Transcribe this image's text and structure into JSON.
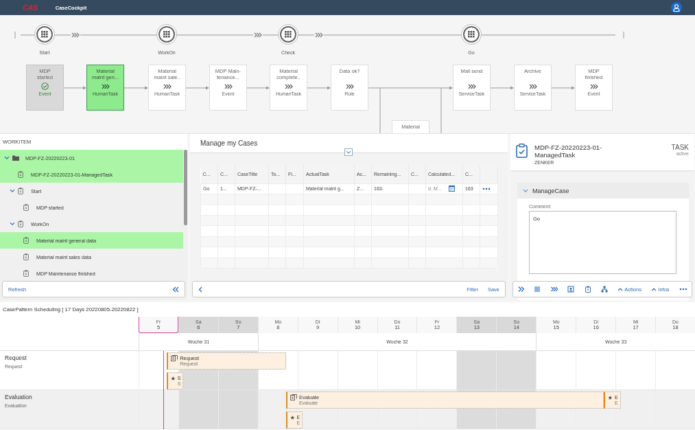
{
  "app": {
    "logo": "CAS",
    "title": "CaseCockpit"
  },
  "milestones": [
    {
      "label": "Start"
    },
    {
      "label": "WorkOn"
    },
    {
      "label": "Check"
    },
    {
      "label": "Go"
    }
  ],
  "tasks": [
    {
      "title": "MDP started",
      "type": "Event",
      "completed": true,
      "selected": false
    },
    {
      "title": "Material maint gen...",
      "type": "HumanTask",
      "completed": false,
      "selected": true
    },
    {
      "title": "Material maint sale..",
      "type": "HumanTask",
      "completed": false,
      "selected": false
    },
    {
      "title": "MDP Main-tenance...",
      "type": "Event",
      "completed": false,
      "selected": false
    },
    {
      "title": "Material complete..",
      "type": "HumanTask",
      "completed": false,
      "selected": false
    },
    {
      "title": "Data ok?",
      "type": "Rule",
      "completed": false,
      "selected": false
    },
    {
      "title": "Mail send",
      "type": "ServiceTask",
      "completed": false,
      "selected": false
    },
    {
      "title": "Archive",
      "type": "ServiceTask",
      "completed": false,
      "selected": false
    },
    {
      "title": "MDP finished",
      "type": "Event",
      "completed": false,
      "selected": false
    }
  ],
  "branch_task": {
    "title": "Material"
  },
  "workitem": {
    "title": "WORKITEM",
    "refresh": "Refresh",
    "tree": [
      {
        "label": "MDP-FZ-20220223-01",
        "kind": "folder",
        "selected": true,
        "expanded": true,
        "children": [
          {
            "label": "MDP-FZ-20220223-01-ManagedTask",
            "kind": "task",
            "selected": true
          },
          {
            "label": "Start",
            "kind": "task",
            "selected": false,
            "expanded": true,
            "children": [
              {
                "label": "MDP started",
                "kind": "task",
                "selected": false
              }
            ]
          },
          {
            "label": "WorkOn",
            "kind": "task",
            "selected": false,
            "expanded": true,
            "children": [
              {
                "label": "Material maint general data",
                "kind": "task",
                "selected": true
              },
              {
                "label": "Material maint sales data",
                "kind": "task",
                "selected": false
              },
              {
                "label": "MDP Maintenance finished",
                "kind": "task",
                "selected": false
              }
            ]
          }
        ]
      }
    ]
  },
  "cases": {
    "title": "Manage my Cases",
    "columns": [
      "C...",
      "C...",
      "CaseTitle",
      "To...",
      "Fi...",
      "ActualTask",
      "Ac...",
      "Remaining...",
      "C...",
      "Calculated...",
      "C..."
    ],
    "rows": [
      {
        "cells": [
          "Go",
          "1...",
          "MDP-FZ-...",
          null,
          null,
          "Material maint g...",
          "Z...",
          "163-",
          null,
          {
            "kind": "date",
            "placeholder": "d. M..."
          },
          "163"
        ]
      }
    ],
    "toolbar": [
      "Filter",
      "Save"
    ]
  },
  "task": {
    "title": "MDP-FZ-20220223-01-ManagedTask",
    "subtitle": "ZENKER",
    "type": "TASK",
    "status": "active",
    "section": {
      "title": "ManageCase",
      "expanded": true,
      "field_label": "Comment:",
      "value": "Go"
    },
    "menus": [
      "Actions",
      "Infos"
    ]
  },
  "scheduler": {
    "title": "CasePattern Scheduling [ 17 Days 20220805-20220822 ]",
    "weeks": [
      {
        "label": "Woche 31",
        "days": [
          {
            "weekday": "Fr",
            "day": "5",
            "weekend": false,
            "today": true
          },
          {
            "weekday": "Sa",
            "day": "6",
            "weekend": true,
            "today": false
          },
          {
            "weekday": "So",
            "day": "7",
            "weekend": true,
            "today": false
          }
        ]
      },
      {
        "label": "Woche 32",
        "days": [
          {
            "weekday": "Mo",
            "day": "8",
            "weekend": false,
            "today": false
          },
          {
            "weekday": "Di",
            "day": "9",
            "weekend": false,
            "today": false
          },
          {
            "weekday": "Mi",
            "day": "10",
            "weekend": false,
            "today": false
          },
          {
            "weekday": "Do",
            "day": "11",
            "weekend": false,
            "today": false
          },
          {
            "weekday": "Fr",
            "day": "12",
            "weekend": false,
            "today": false
          },
          {
            "weekday": "Sa",
            "day": "13",
            "weekend": true,
            "today": false
          },
          {
            "weekday": "So",
            "day": "14",
            "weekend": true,
            "today": false
          }
        ]
      },
      {
        "label": "Woche 33",
        "days": [
          {
            "weekday": "Mo",
            "day": "15",
            "weekend": false,
            "today": false
          },
          {
            "weekday": "Di",
            "day": "16",
            "weekend": false,
            "today": false
          },
          {
            "weekday": "Mi",
            "day": "17",
            "weekend": false,
            "today": false
          },
          {
            "weekday": "Do",
            "day": "18",
            "weekend": false,
            "today": false
          }
        ]
      }
    ],
    "lanes": [
      {
        "title": "Request",
        "subtitle": "Request",
        "tracks": [
          [
            {
              "kind": "task",
              "title": "Request",
              "subtitle": "Request"
            }
          ],
          [
            {
              "kind": "milestone",
              "title": "S",
              "subtitle": "S"
            }
          ]
        ]
      },
      {
        "title": "Evaluation",
        "subtitle": "Evaluation",
        "tracks": [
          [
            {
              "kind": "task",
              "title": "Evaluate",
              "subtitle": "Evaluate"
            },
            {
              "kind": "milestone",
              "title": "E",
              "subtitle": "E"
            }
          ],
          [
            {
              "kind": "milestone",
              "title": "E",
              "subtitle": "E"
            }
          ]
        ]
      }
    ]
  }
}
